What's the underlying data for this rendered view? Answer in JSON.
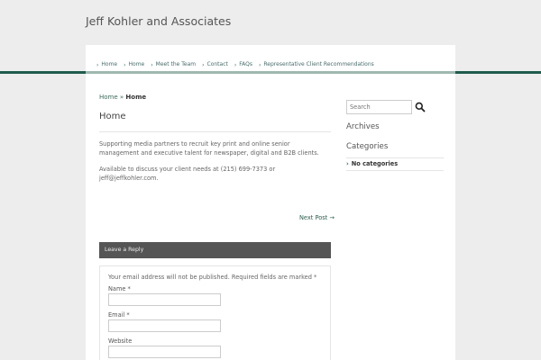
{
  "site": {
    "title": "Jeff Kohler and Associates"
  },
  "nav": {
    "items": [
      "Home",
      "Home",
      "Meet the Team",
      "Contact",
      "FAQs",
      "Representative Client Recommendations"
    ]
  },
  "breadcrumb": {
    "link": "Home",
    "separator": " » ",
    "current": "Home"
  },
  "page": {
    "title": "Home",
    "paragraph1": "Supporting media partners to recruit key print and online senior management and executive talent for newspaper, digital and B2B clients.",
    "paragraph2": "Available to discuss your client needs at (215) 699-7373 or jeff@jeffkohler.com.",
    "next_post": "Next Post →"
  },
  "reply": {
    "header": "Leave a Reply",
    "note": "Your email address will not be published. Required fields are marked *",
    "name_label": "Name *",
    "email_label": "Email *",
    "website_label": "Website"
  },
  "sidebar": {
    "search_placeholder": "Search",
    "archives_title": "Archives",
    "categories_title": "Categories",
    "no_categories": "No categories"
  },
  "colors": {
    "accent": "#1f5c4d",
    "link": "#2f5f50",
    "background": "#ededed"
  }
}
